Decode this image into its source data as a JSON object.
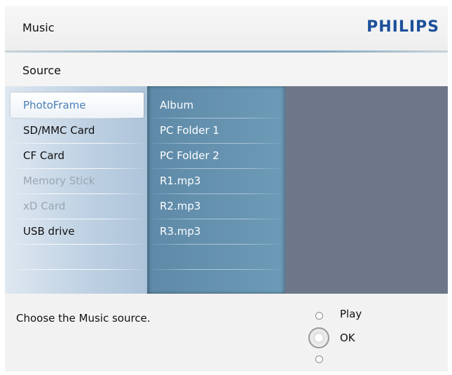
{
  "header": {
    "title": "Music",
    "brand": "PHILIPS"
  },
  "subheader": {
    "title": "Source"
  },
  "sources": [
    {
      "label": "PhotoFrame",
      "state": "selected"
    },
    {
      "label": "SD/MMC Card",
      "state": "enabled"
    },
    {
      "label": "CF Card",
      "state": "enabled"
    },
    {
      "label": "Memory Stick",
      "state": "disabled"
    },
    {
      "label": "xD Card",
      "state": "disabled"
    },
    {
      "label": "USB drive",
      "state": "enabled"
    }
  ],
  "items": [
    {
      "label": "Album"
    },
    {
      "label": "PC Folder 1"
    },
    {
      "label": "PC Folder 2"
    },
    {
      "label": "R1.mp3"
    },
    {
      "label": "R2.mp3"
    },
    {
      "label": "R3.mp3"
    }
  ],
  "footer": {
    "hint": "Choose the Music source.",
    "play_label": "Play",
    "ok_label": "OK"
  },
  "colors": {
    "brand": "#1c4f9a",
    "selected_text": "#4a7fb5",
    "panel_bg": "#6d7789"
  }
}
